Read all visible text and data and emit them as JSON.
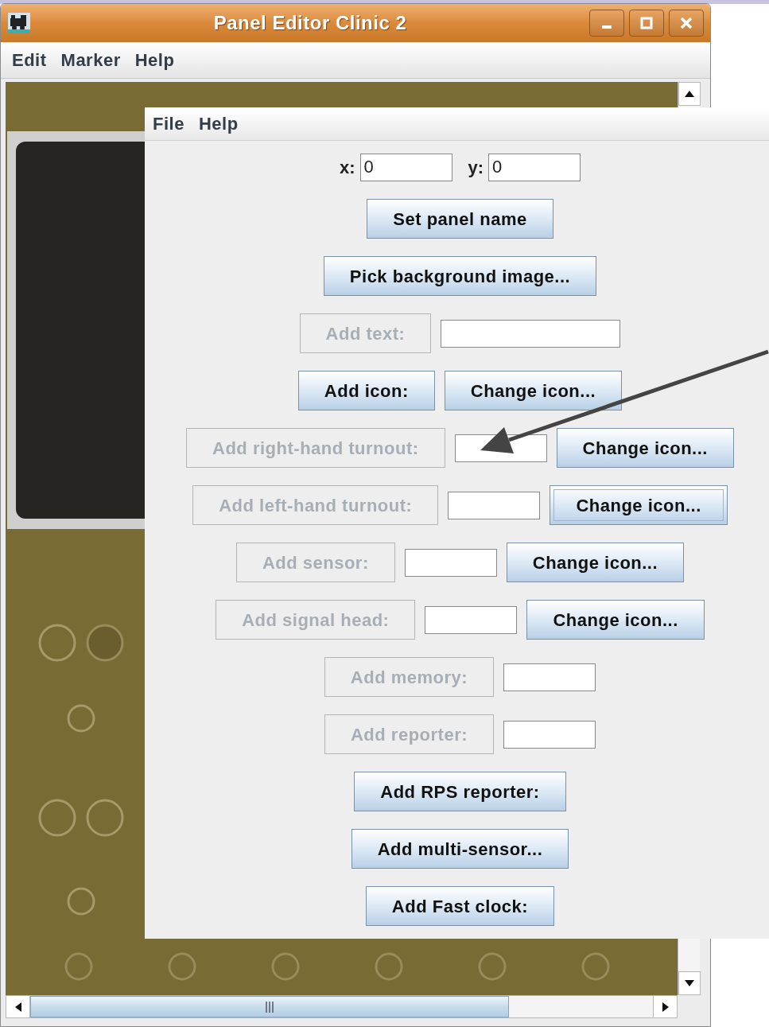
{
  "main_window": {
    "title": "Panel Editor Clinic 2",
    "menu": [
      "Edit",
      "Marker",
      "Help"
    ]
  },
  "palette_window": {
    "menu": [
      "File",
      "Help"
    ],
    "rows": [
      {
        "controls": [
          {
            "kind": "label",
            "text": "x:"
          },
          {
            "kind": "field",
            "value": "0"
          },
          {
            "kind": "label",
            "text": "y:"
          },
          {
            "kind": "field",
            "value": "0"
          }
        ]
      },
      {
        "controls": [
          {
            "kind": "button",
            "label": "Set panel name",
            "disabled": false,
            "focused": false
          }
        ]
      },
      {
        "controls": [
          {
            "kind": "button",
            "label": "Pick background image...",
            "disabled": false,
            "focused": false
          }
        ]
      },
      {
        "controls": [
          {
            "kind": "button",
            "label": "Add text:",
            "disabled": true,
            "focused": false
          },
          {
            "kind": "wide_field"
          }
        ]
      },
      {
        "controls": [
          {
            "kind": "button",
            "label": "Add icon:",
            "disabled": false,
            "focused": false
          },
          {
            "kind": "button",
            "label": "Change icon...",
            "disabled": false,
            "focused": false
          }
        ]
      },
      {
        "controls": [
          {
            "kind": "button",
            "label": "Add right-hand turnout:",
            "disabled": true,
            "focused": false
          },
          {
            "kind": "field"
          },
          {
            "kind": "button",
            "label": "Change icon...",
            "disabled": false,
            "focused": false
          }
        ]
      },
      {
        "controls": [
          {
            "kind": "button",
            "label": "Add left-hand turnout:",
            "disabled": true,
            "focused": false
          },
          {
            "kind": "field"
          },
          {
            "kind": "button",
            "label": "Change icon...",
            "disabled": false,
            "focused": true
          }
        ]
      },
      {
        "controls": [
          {
            "kind": "button",
            "label": "Add sensor:",
            "disabled": true,
            "focused": false
          },
          {
            "kind": "field"
          },
          {
            "kind": "button",
            "label": "Change icon...",
            "disabled": false,
            "focused": false
          }
        ]
      },
      {
        "controls": [
          {
            "kind": "button",
            "label": "Add signal head:",
            "disabled": true,
            "focused": false
          },
          {
            "kind": "field"
          },
          {
            "kind": "button",
            "label": "Change icon...",
            "disabled": false,
            "focused": false
          }
        ]
      },
      {
        "controls": [
          {
            "kind": "button",
            "label": "Add memory:",
            "disabled": true,
            "focused": false
          },
          {
            "kind": "field"
          }
        ]
      },
      {
        "controls": [
          {
            "kind": "button",
            "label": "Add reporter:",
            "disabled": true,
            "focused": false
          },
          {
            "kind": "field"
          }
        ]
      },
      {
        "controls": [
          {
            "kind": "button",
            "label": "Add RPS reporter:",
            "disabled": false,
            "focused": false
          }
        ]
      },
      {
        "controls": [
          {
            "kind": "button",
            "label": "Add multi-sensor...",
            "disabled": false,
            "focused": false
          }
        ]
      },
      {
        "controls": [
          {
            "kind": "button",
            "label": "Add Fast clock:",
            "disabled": false,
            "focused": false
          }
        ]
      }
    ]
  }
}
